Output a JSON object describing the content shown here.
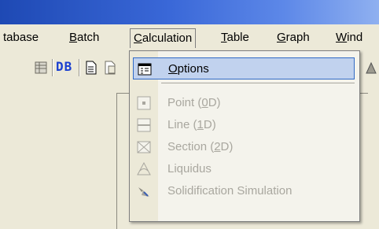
{
  "menubar": {
    "items": [
      {
        "label": "tabase",
        "mn": "",
        "rest": ""
      },
      {
        "label": "",
        "mn": "B",
        "rest": "atch"
      },
      {
        "label": "",
        "mn": "C",
        "rest": "alculation"
      },
      {
        "label": "",
        "mn": "T",
        "rest": "able"
      },
      {
        "label": "",
        "mn": "G",
        "rest": "raph"
      },
      {
        "label": "",
        "mn": "W",
        "rest": "ind"
      }
    ]
  },
  "toolbar": {
    "db_label": "DB"
  },
  "calculation_menu": {
    "items": [
      {
        "pre": "",
        "mn": "O",
        "post": "ptions",
        "icon": "options-icon",
        "enabled": true,
        "selected": true
      },
      {
        "pre": "Point (",
        "mn": "0",
        "post": "D)",
        "icon": "point-icon",
        "enabled": false
      },
      {
        "pre": "Line (",
        "mn": "1",
        "post": "D)",
        "icon": "line-icon",
        "enabled": false
      },
      {
        "pre": "Section (",
        "mn": "2",
        "post": "D)",
        "icon": "section-icon",
        "enabled": false
      },
      {
        "pre": "Liquidus",
        "mn": "",
        "post": "",
        "icon": "liquidus-icon",
        "enabled": false
      },
      {
        "pre": "Solidification Simulation",
        "mn": "",
        "post": "",
        "icon": "solidification-icon",
        "enabled": false
      }
    ]
  },
  "colors": {
    "title_blue": "#1e49b4",
    "highlight_fill": "#c1d2ee",
    "highlight_border": "#316ac5",
    "disabled_text": "#a9a79f",
    "db_blue": "#1a3fd0"
  }
}
